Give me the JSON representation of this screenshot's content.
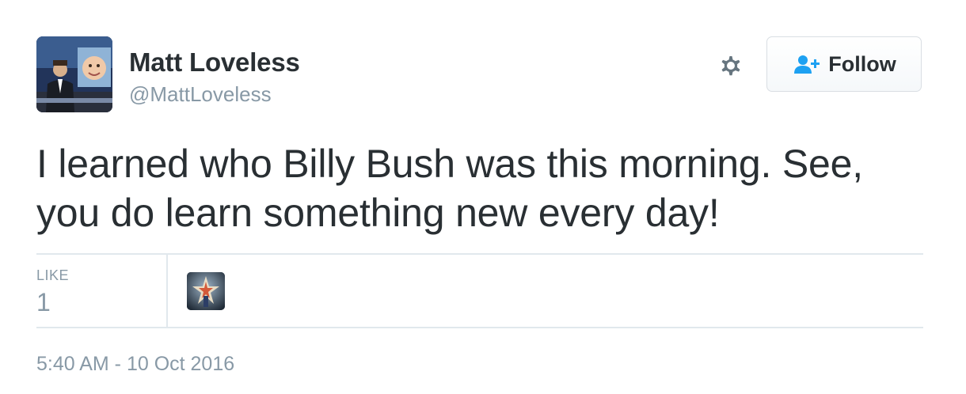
{
  "author": {
    "display_name": "Matt Loveless",
    "handle": "@MattLoveless",
    "avatar_icon": "profile-photo"
  },
  "actions": {
    "settings_icon": "gear-icon",
    "follow_icon": "add-user-icon",
    "follow_label": "Follow"
  },
  "tweet": {
    "text": "I learned who Billy Bush was this morning. See, you do learn something new every day!",
    "timestamp": "5:40 AM - 10 Oct 2016"
  },
  "stats": {
    "like_label": "LIKE",
    "like_count": "1"
  },
  "likers": [
    {
      "avatar_icon": "liker-avatar"
    }
  ],
  "colors": {
    "text": "#292f33",
    "muted": "#8899a6",
    "accent": "#1da1f2",
    "divider": "#e1e8ed"
  }
}
